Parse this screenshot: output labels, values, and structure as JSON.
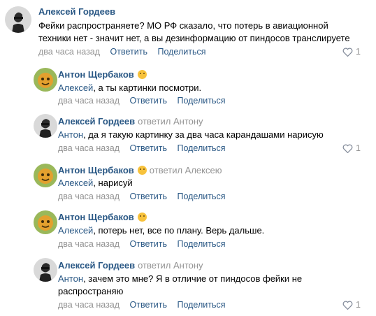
{
  "comments": [
    {
      "author": "Алексей Гордеев",
      "reply_to": "",
      "addressee": "",
      "lines": [
        "Фейки распространяете? МО РФ сказало, что потерь в авиационной",
        "техники нет - значит нет, а вы дезинформацию от пиндосов транслируете"
      ],
      "time": "два часа назад",
      "reply_label": "Ответить",
      "share_label": "Поделиться",
      "likes": "1"
    },
    {
      "author": "Антон Щербаков",
      "reply_to": "",
      "addressee": "Алексей",
      "lines": [
        ", а ты картинки посмотри."
      ],
      "time": "два часа назад",
      "reply_label": "Ответить",
      "share_label": "Поделиться",
      "likes": ""
    },
    {
      "author": "Алексей Гордеев",
      "reply_to": "ответил Антону",
      "addressee": "Антон",
      "lines": [
        ", да я такую картинку за два часа карандашами нарисую"
      ],
      "time": "два часа назад",
      "reply_label": "Ответить",
      "share_label": "Поделиться",
      "likes": "1"
    },
    {
      "author": "Антон Щербаков",
      "reply_to": "ответил Алексею",
      "addressee": "Алексей",
      "lines": [
        ", нарисуй"
      ],
      "time": "два часа назад",
      "reply_label": "Ответить",
      "share_label": "Поделиться",
      "likes": ""
    },
    {
      "author": "Антон Щербаков",
      "reply_to": "",
      "addressee": "Алексей",
      "lines": [
        ", потерь нет, все по плану. Верь дальше."
      ],
      "time": "два часа назад",
      "reply_label": "Ответить",
      "share_label": "Поделиться",
      "likes": ""
    },
    {
      "author": "Алексей Гордеев",
      "reply_to": "ответил Антону",
      "addressee": "Антон",
      "lines": [
        ", зачем это мне? Я в отличие от пиндосов фейки не",
        "распространяю"
      ],
      "time": "два часа назад",
      "reply_label": "Ответить",
      "share_label": "Поделиться",
      "likes": "1"
    }
  ]
}
